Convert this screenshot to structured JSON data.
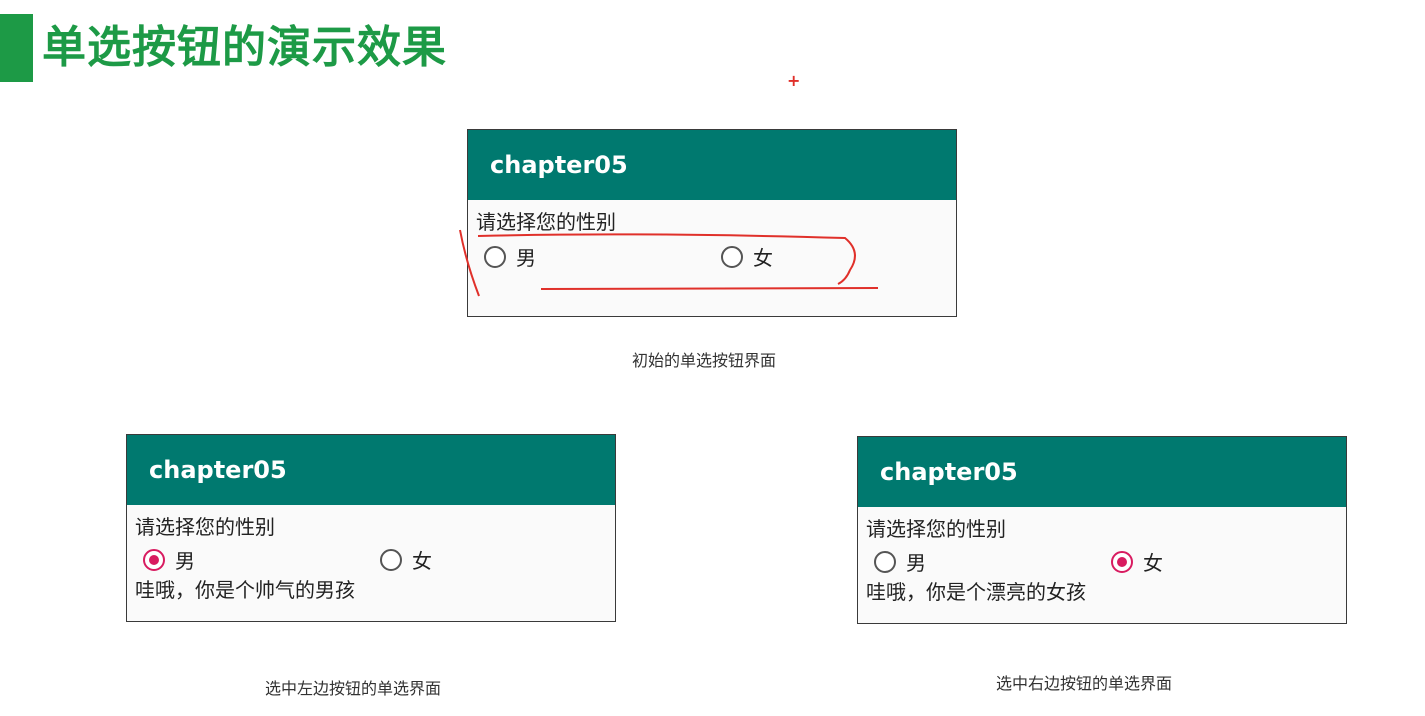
{
  "slide": {
    "title": "单选按钮的演示效果",
    "accent_color": "#1d9a46"
  },
  "screens": [
    {
      "app_title": "chapter05",
      "prompt": "请选择您的性别",
      "options": [
        {
          "label": "男",
          "checked": false
        },
        {
          "label": "女",
          "checked": false
        }
      ],
      "result": "",
      "caption": "初始的单选按钮界面"
    },
    {
      "app_title": "chapter05",
      "prompt": "请选择您的性别",
      "options": [
        {
          "label": "男",
          "checked": true
        },
        {
          "label": "女",
          "checked": false
        }
      ],
      "result": "哇哦，你是个帅气的男孩",
      "caption": "选中左边按钮的单选界面"
    },
    {
      "app_title": "chapter05",
      "prompt": "请选择您的性别",
      "options": [
        {
          "label": "男",
          "checked": false
        },
        {
          "label": "女",
          "checked": true
        }
      ],
      "result": "哇哦，你是个漂亮的女孩",
      "caption": "选中右边按钮的单选界面"
    }
  ],
  "colors": {
    "app_bar": "#00796f",
    "radio_checked": "#d81b60",
    "annotation": "#e0302a"
  }
}
